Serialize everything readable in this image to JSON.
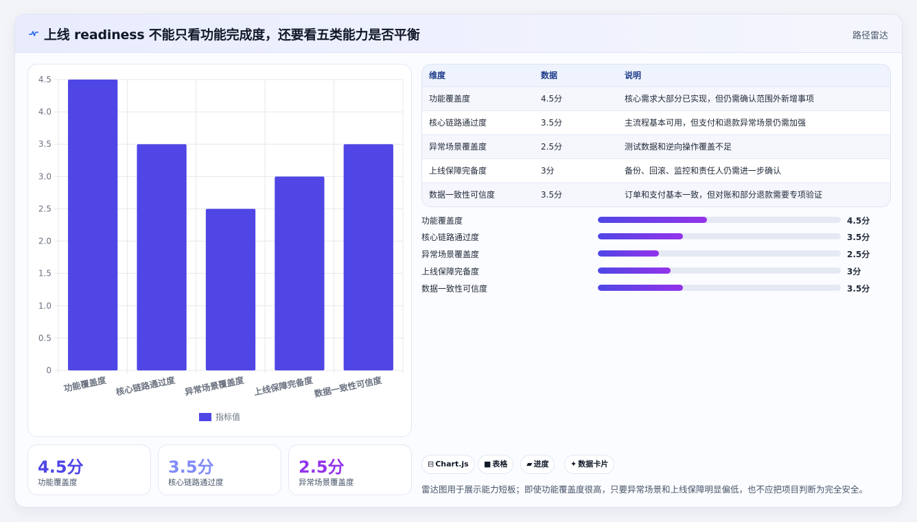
{
  "header": {
    "title": "上线 readiness 不能只看功能完成度，还要看五类能力是否平衡",
    "right_label": "路径雷达",
    "icon": "pulse-icon"
  },
  "chart_data": {
    "type": "bar",
    "categories": [
      "功能覆盖度",
      "核心链路通过度",
      "异常场景覆盖度",
      "上线保障完备度",
      "数据一致性可信度"
    ],
    "series": [
      {
        "name": "指标值",
        "values": [
          4.5,
          3.5,
          2.5,
          3,
          3.5
        ]
      }
    ],
    "yticks": [
      "0",
      "0.5",
      "1.0",
      "1.5",
      "2.0",
      "2.5",
      "3.0",
      "3.5",
      "4.0",
      "4.5"
    ],
    "ylim": [
      0,
      4.5
    ],
    "grid": true,
    "legend": "bottom",
    "color": "#4f46e5"
  },
  "stat_cards": [
    {
      "value": "4.5分",
      "label": "功能覆盖度",
      "color": "#4f46e5"
    },
    {
      "value": "3.5分",
      "label": "核心链路通过度",
      "color": "#818cf8"
    },
    {
      "value": "2.5分",
      "label": "异常场景覆盖度",
      "color": "#9333ea"
    }
  ],
  "table": {
    "headers": [
      "维度",
      "数据",
      "说明"
    ],
    "rows": [
      [
        "功能覆盖度",
        "4.5分",
        "核心需求大部分已实现，但仍需确认范围外新增事项"
      ],
      [
        "核心链路通过度",
        "3.5分",
        "主流程基本可用，但支付和退款异常场景仍需加强"
      ],
      [
        "异常场景覆盖度",
        "2.5分",
        "测试数据和逆向操作覆盖不足"
      ],
      [
        "上线保障完备度",
        "3分",
        "备份、回滚、监控和责任人仍需进一步确认"
      ],
      [
        "数据一致性可信度",
        "3.5分",
        "订单和支付基本一致，但对账和部分退款需要专项验证"
      ]
    ]
  },
  "progress": {
    "max": 10,
    "items": [
      {
        "label": "功能覆盖度",
        "value": 4.5,
        "value_text": "4.5分"
      },
      {
        "label": "核心链路通过度",
        "value": 3.5,
        "value_text": "3.5分"
      },
      {
        "label": "异常场景覆盖度",
        "value": 2.5,
        "value_text": "2.5分"
      },
      {
        "label": "上线保障完备度",
        "value": 3,
        "value_text": "3分"
      },
      {
        "label": "数据一致性可信度",
        "value": 3.5,
        "value_text": "3.5分"
      }
    ]
  },
  "chips": [
    {
      "icon": "⊟",
      "icon_name": "chart-icon",
      "label": "Chart.js"
    },
    {
      "icon": "■",
      "icon_name": "table-icon",
      "label": "表格"
    },
    {
      "icon": "▰",
      "icon_name": "progress-icon",
      "label": "进度"
    },
    {
      "icon": "✦",
      "icon_name": "sparkle-icon",
      "label": "数据卡片"
    }
  ],
  "footer": {
    "note": "雷达图用于展示能力短板；即使功能覆盖度很高，只要异常场景和上线保障明显偏低，也不应把项目判断为完全安全。"
  }
}
